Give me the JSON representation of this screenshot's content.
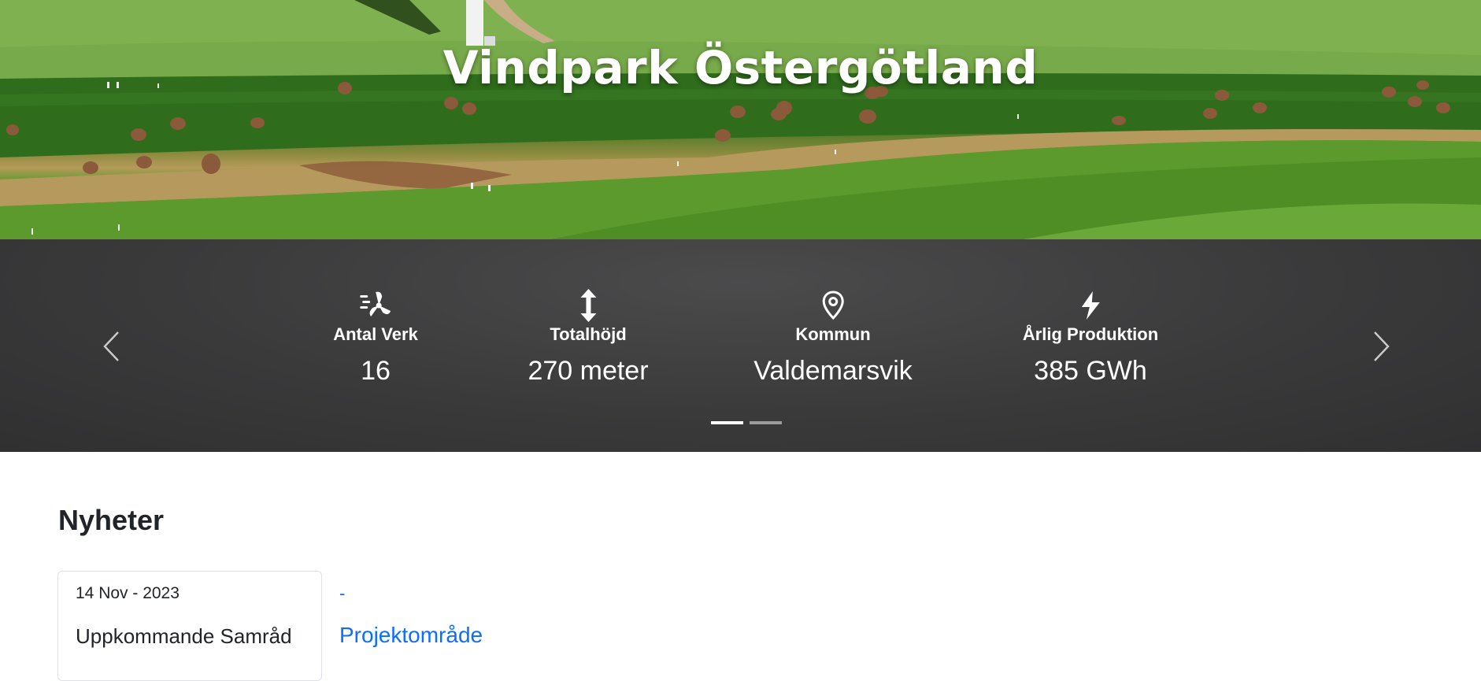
{
  "hero": {
    "title": "Vindpark Östergötland"
  },
  "stats": {
    "items": [
      {
        "icon": "wind-turbine-icon",
        "label": "Antal Verk",
        "value": "16"
      },
      {
        "icon": "vertical-arrows-icon",
        "label": "Totalhöjd",
        "value": "270 meter"
      },
      {
        "icon": "location-pin-icon",
        "label": "Kommun",
        "value": "Valdemarsvik"
      },
      {
        "icon": "lightning-bolt-icon",
        "label": "Årlig Produktion",
        "value": "385 GWh"
      }
    ],
    "prev_icon": "chevron-left-icon",
    "next_icon": "chevron-right-icon",
    "slide_count": 2,
    "active_slide": 1
  },
  "news": {
    "heading": "Nyheter",
    "card": {
      "date": "14 Nov - 2023",
      "title": "Uppkommande Samråd"
    },
    "links": {
      "dash": "-",
      "project_area": "Projektområde"
    }
  },
  "colors": {
    "stats_bg": "#3a3a3b",
    "link": "#0d6efd",
    "text": "#212529"
  }
}
